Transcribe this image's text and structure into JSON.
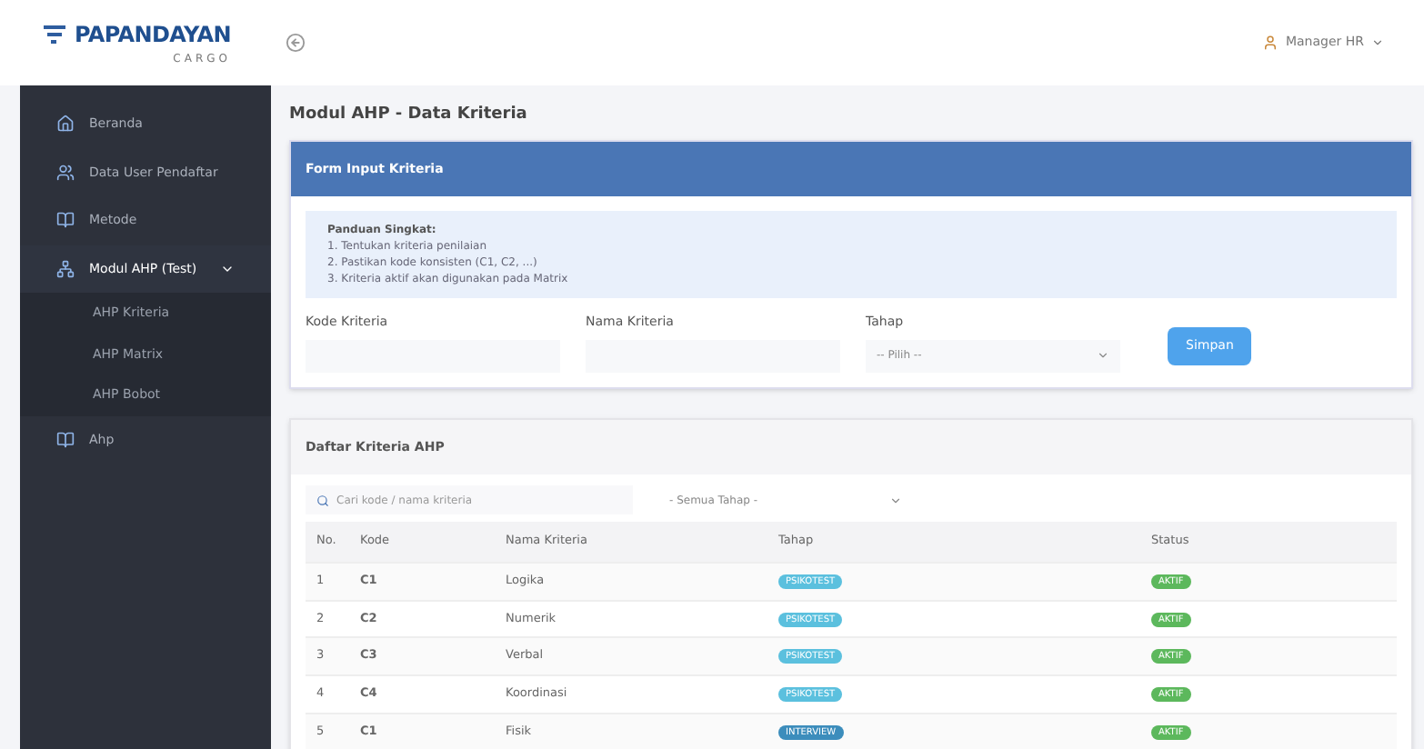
{
  "header": {
    "logo_main": "PAPANDAYAN",
    "logo_sub": "CARGO",
    "user": "Manager HR"
  },
  "sidebar": {
    "items": [
      {
        "label": "Beranda",
        "selected": false
      },
      {
        "label": "Data User Pendaftar",
        "selected": false
      },
      {
        "label": "Metode",
        "selected": false
      },
      {
        "label": "Modul AHP (Test)",
        "expanded": true,
        "selected": true,
        "children": [
          {
            "label": "AHP Kriteria",
            "selected": false
          },
          {
            "label": "AHP Matrix",
            "selected": false
          },
          {
            "label": "AHP Bobot",
            "selected": false
          }
        ]
      },
      {
        "label": "Ahp",
        "selected": false
      }
    ]
  },
  "page_title": "Modul AHP - Data Kriteria",
  "form": {
    "title": "Form Input Kriteria",
    "guide_title": "Panduan Singkat:",
    "guide": [
      "1. Tentukan kriteria penilaian",
      "2. Pastikan kode konsisten (C1, C2, ...)",
      "3. Kriteria aktif akan digunakan pada Matrix"
    ],
    "fields": [
      {
        "kind": "text",
        "label": "Kode Kriteria"
      },
      {
        "kind": "text",
        "label": "Nama Kriteria"
      },
      {
        "kind": "select",
        "label": "Tahap",
        "value": "-- Pilih --"
      }
    ],
    "button": "Simpan"
  },
  "list": {
    "title": "Daftar Kriteria AHP",
    "search_placeholder": "Cari kode / nama kriteria",
    "filter_value": "- Semua Tahap -",
    "columns": [
      "No.",
      "Kode",
      "Nama Kriteria",
      "Tahap",
      "Status"
    ],
    "rows": [
      {
        "no": "1",
        "kode": "C1",
        "nama": "Logika",
        "tahap": "PSIKOTEST",
        "color": "#5bc0de",
        "status": "AKTIF"
      },
      {
        "no": "2",
        "kode": "C2",
        "nama": "Numerik",
        "tahap": "PSIKOTEST",
        "color": "#5bc0de",
        "status": "AKTIF"
      },
      {
        "no": "3",
        "kode": "C3",
        "nama": "Verbal",
        "tahap": "PSIKOTEST",
        "color": "#5bc0de",
        "status": "AKTIF"
      },
      {
        "no": "4",
        "kode": "C4",
        "nama": "Koordinasi",
        "tahap": "PSIKOTEST",
        "color": "#5bc0de",
        "status": "AKTIF"
      },
      {
        "no": "5",
        "kode": "C1",
        "nama": "Fisik",
        "tahap": "INTERVIEW",
        "color": "#3c8dbc",
        "status": "AKTIF"
      }
    ]
  }
}
